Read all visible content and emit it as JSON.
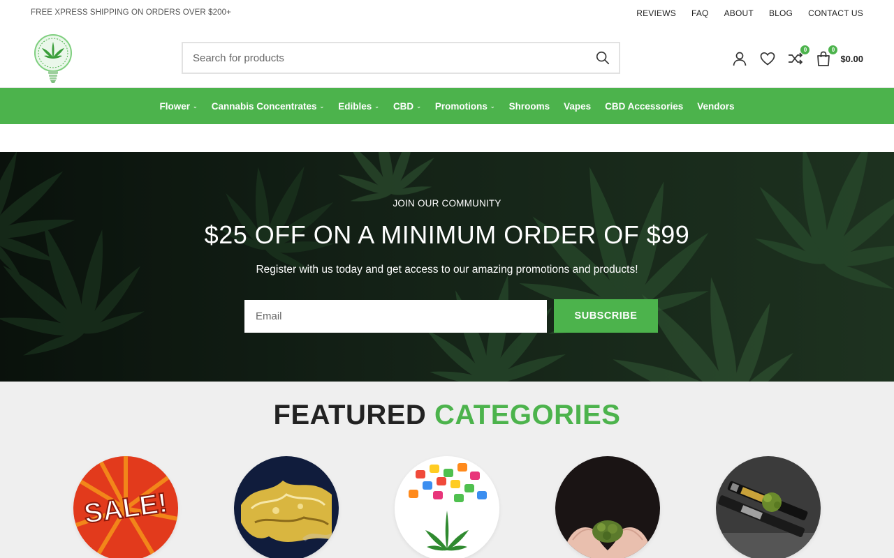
{
  "topbar": {
    "shipping_text": "FREE XPRESS SHIPPING ON ORDERS OVER $200+",
    "links": [
      "REVIEWS",
      "FAQ",
      "ABOUT",
      "BLOG",
      "CONTACT US"
    ]
  },
  "header": {
    "search_placeholder": "Search for products",
    "compare_count": "0",
    "cart_count": "0",
    "cart_total": "$0.00"
  },
  "nav": {
    "items": [
      {
        "label": "Flower",
        "dropdown": true
      },
      {
        "label": "Cannabis Concentrates",
        "dropdown": true
      },
      {
        "label": "Edibles",
        "dropdown": true
      },
      {
        "label": "CBD",
        "dropdown": true
      },
      {
        "label": "Promotions",
        "dropdown": true
      },
      {
        "label": "Shrooms",
        "dropdown": false
      },
      {
        "label": "Vapes",
        "dropdown": false
      },
      {
        "label": "CBD Accessories",
        "dropdown": false
      },
      {
        "label": "Vendors",
        "dropdown": false
      }
    ]
  },
  "banner": {
    "pretitle": "JOIN OUR COMMUNITY",
    "headline": "$25 OFF ON A MINIMUM ORDER OF $99",
    "subtitle": "Register with us today and get access to our amazing promotions and products!",
    "email_placeholder": "Email",
    "subscribe_label": "SUBSCRIBE"
  },
  "featured": {
    "title_part1": "FEATURED",
    "title_part2": "CATEGORIES",
    "categories": [
      {
        "image_text": "SALE!"
      },
      {},
      {},
      {},
      {}
    ]
  },
  "colors": {
    "accent": "#4cb34c",
    "text_dark": "#222222",
    "featured_bg": "#efefef"
  },
  "icons": [
    "search-icon",
    "user-icon",
    "heart-icon",
    "compare-icon",
    "cart-icon",
    "chevron-down-icon"
  ]
}
